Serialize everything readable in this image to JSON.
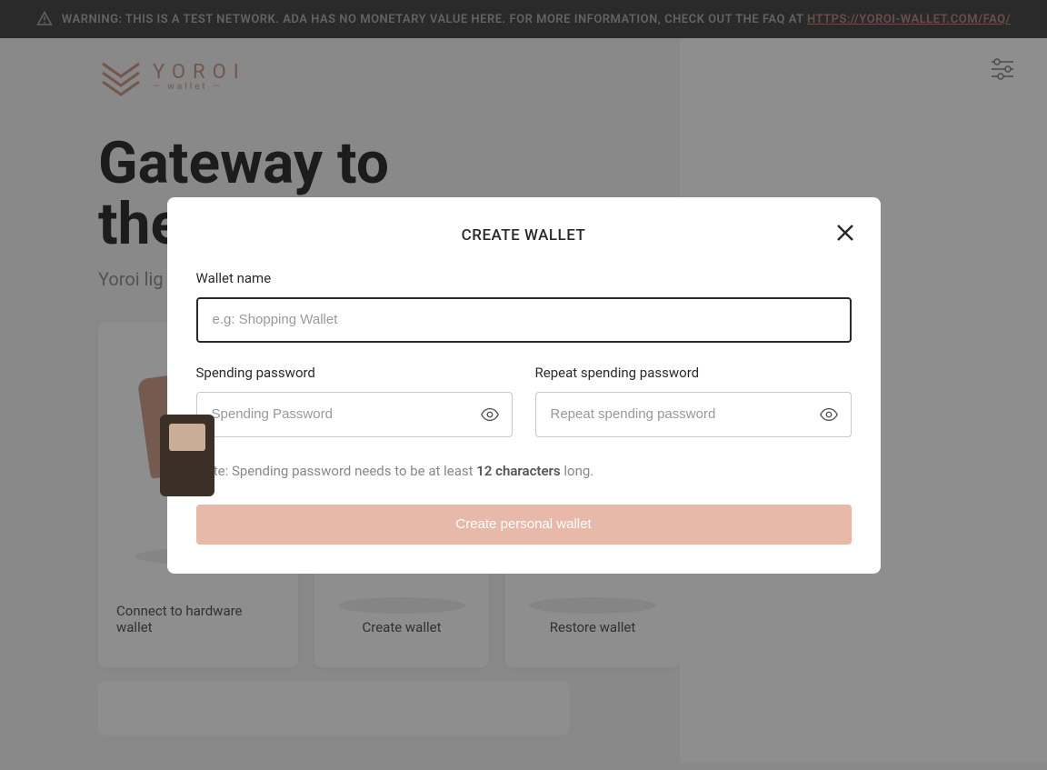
{
  "banner": {
    "warning_text": "WARNING: THIS IS A TEST NETWORK. ADA HAS NO MONETARY VALUE HERE. FOR MORE INFORMATION, CHECK OUT THE FAQ AT ",
    "link_text": "HTTPS://YOROI-WALLET.COM/FAQ/"
  },
  "logo": {
    "name": "YOROI",
    "subtext": "— wallet —"
  },
  "hero": {
    "title": "Gateway to the financial",
    "subtitle": "Yoroi lig"
  },
  "cards": [
    {
      "label": "Connect to hardware wallet"
    },
    {
      "label": "Create wallet"
    },
    {
      "label": "Restore wallet"
    }
  ],
  "modal": {
    "title": "CREATE WALLET",
    "wallet_name_label": "Wallet name",
    "wallet_name_placeholder": "e.g: Shopping Wallet",
    "wallet_name_value": "",
    "spending_password_label": "Spending password",
    "spending_password_placeholder": "Spending Password",
    "spending_password_value": "",
    "repeat_password_label": "Repeat spending password",
    "repeat_password_placeholder": "Repeat spending password",
    "repeat_password_value": "",
    "note_prefix": "Note: Spending password needs to be at least ",
    "note_bold": "12 characters",
    "note_suffix": " long.",
    "submit_label": "Create personal wallet"
  }
}
